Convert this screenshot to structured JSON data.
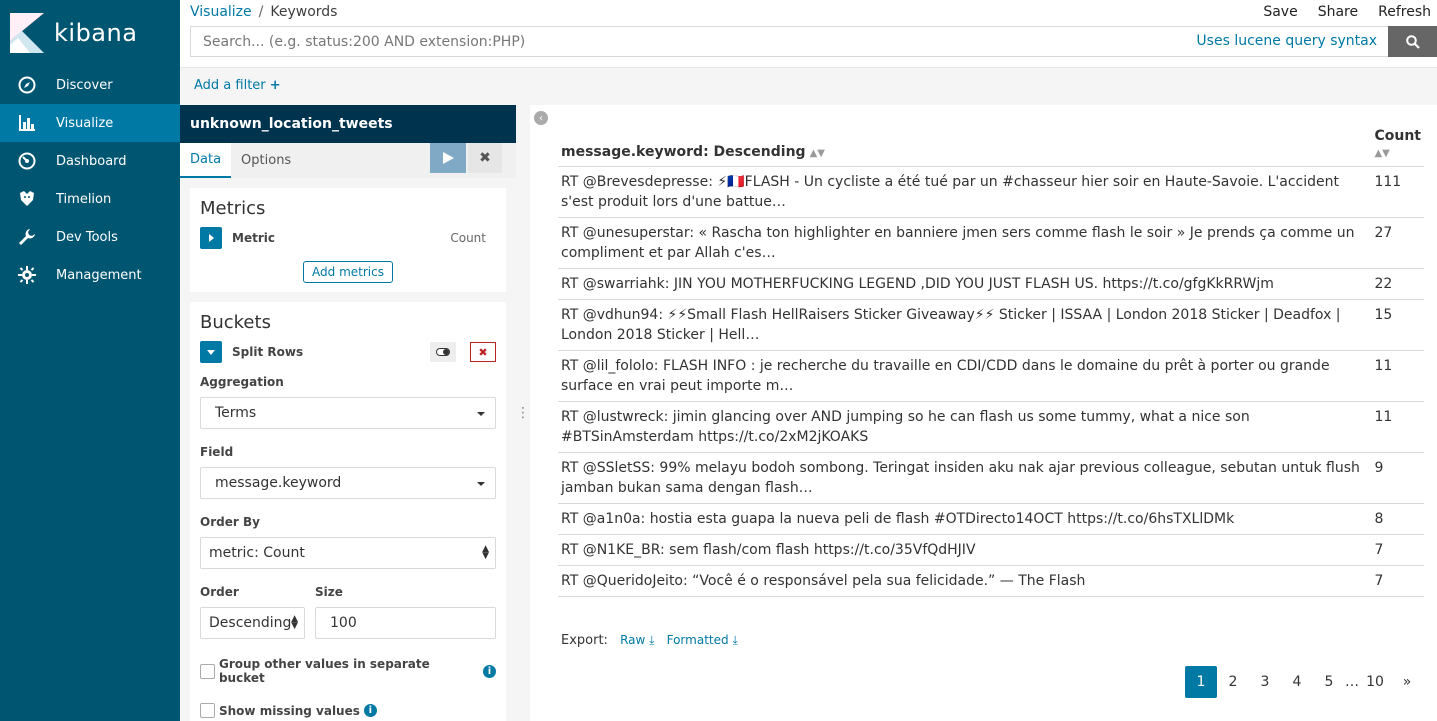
{
  "brand": {
    "name": "kibana"
  },
  "nav": [
    {
      "label": "Discover",
      "icon": "compass-icon"
    },
    {
      "label": "Visualize",
      "icon": "bar-chart-icon",
      "active": true
    },
    {
      "label": "Dashboard",
      "icon": "dashboard-icon"
    },
    {
      "label": "Timelion",
      "icon": "timelion-icon"
    },
    {
      "label": "Dev Tools",
      "icon": "wrench-icon"
    },
    {
      "label": "Management",
      "icon": "gear-icon"
    }
  ],
  "breadcrumb": {
    "parent": "Visualize",
    "separator": "/",
    "current": "Keywords"
  },
  "top_actions": {
    "save": "Save",
    "share": "Share",
    "refresh": "Refresh"
  },
  "search": {
    "placeholder": "Search... (e.g. status:200 AND extension:PHP)",
    "syntax_link": "Uses lucene query syntax"
  },
  "filter": {
    "add_label": "Add a filter"
  },
  "editor": {
    "index_pattern": "unknown_location_tweets",
    "tabs": [
      "Data",
      "Options"
    ],
    "metrics": {
      "title": "Metrics",
      "agg_label": "Metric",
      "agg_value": "Count",
      "add_button": "Add metrics"
    },
    "buckets": {
      "title": "Buckets",
      "split_label": "Split Rows",
      "aggregation_label": "Aggregation",
      "aggregation_value": "Terms",
      "field_label": "Field",
      "field_value": "message.keyword",
      "order_by_label": "Order By",
      "order_by_value": "metric: Count",
      "order_label": "Order",
      "order_value": "Descending",
      "size_label": "Size",
      "size_value": "100",
      "group_other_label": "Group other values in separate bucket",
      "show_missing_label": "Show missing values"
    }
  },
  "table": {
    "col_keyword": "message.keyword: Descending",
    "col_count": "Count",
    "rows": [
      {
        "text": "RT @Brevesdepresse: ⚡🇫🇷FLASH - Un cycliste a été tué par un #chasseur hier soir en Haute-Savoie. L'accident s'est produit lors d'une battue…",
        "count": "111"
      },
      {
        "text": "RT @unesuperstar: « Rascha ton highlighter en banniere jmen sers comme flash le soir » Je prends ça comme un compliment et par Allah c'es…",
        "count": "27"
      },
      {
        "text": "RT @swarriahk: JIN YOU MOTHERFUCKING LEGEND ,DID YOU JUST FLASH US. https://t.co/gfgKkRRWjm",
        "count": "22"
      },
      {
        "text": "RT @vdhun94: ⚡⚡Small Flash HellRaisers Sticker Giveaway⚡⚡ Sticker | ISSAA | London 2018 Sticker | Deadfox | London 2018 Sticker | Hell…",
        "count": "15"
      },
      {
        "text": "RT @lil_fololo: FLASH INFO : je recherche du travaille en CDI/CDD dans le domaine du prêt à porter ou grande surface en vrai peut importe m…",
        "count": "11"
      },
      {
        "text": "RT @lustwreck: jimin glancing over AND jumping so he can flash us some tummy, what a nice son #BTSinAmsterdam https://t.co/2xM2jKOAKS",
        "count": "11"
      },
      {
        "text": "RT @SSletSS: 99% melayu bodoh sombong. Teringat insiden aku nak ajar previous colleague, sebutan untuk flush jamban bukan sama dengan flash…",
        "count": "9"
      },
      {
        "text": "RT @a1n0a: hostia esta guapa la nueva peli de flash #OTDirecto14OCT https://t.co/6hsTXLlDMk",
        "count": "8"
      },
      {
        "text": "RT @N1KE_BR: sem flash/com flash https://t.co/35VfQdHJIV",
        "count": "7"
      },
      {
        "text": "RT @QueridoJeito: “Você é o responsável pela sua felicidade.” — The Flash",
        "count": "7"
      }
    ]
  },
  "export": {
    "label": "Export:",
    "raw": "Raw",
    "formatted": "Formatted"
  },
  "pagination": {
    "pages": [
      "1",
      "2",
      "3",
      "4",
      "5"
    ],
    "ellipsis": "…",
    "last": "10",
    "next": "»",
    "active": "1"
  },
  "colors": {
    "sidebar": "#005571",
    "active_nav": "#0079a5",
    "accent": "#0079a5",
    "index_bar": "#00334d"
  }
}
